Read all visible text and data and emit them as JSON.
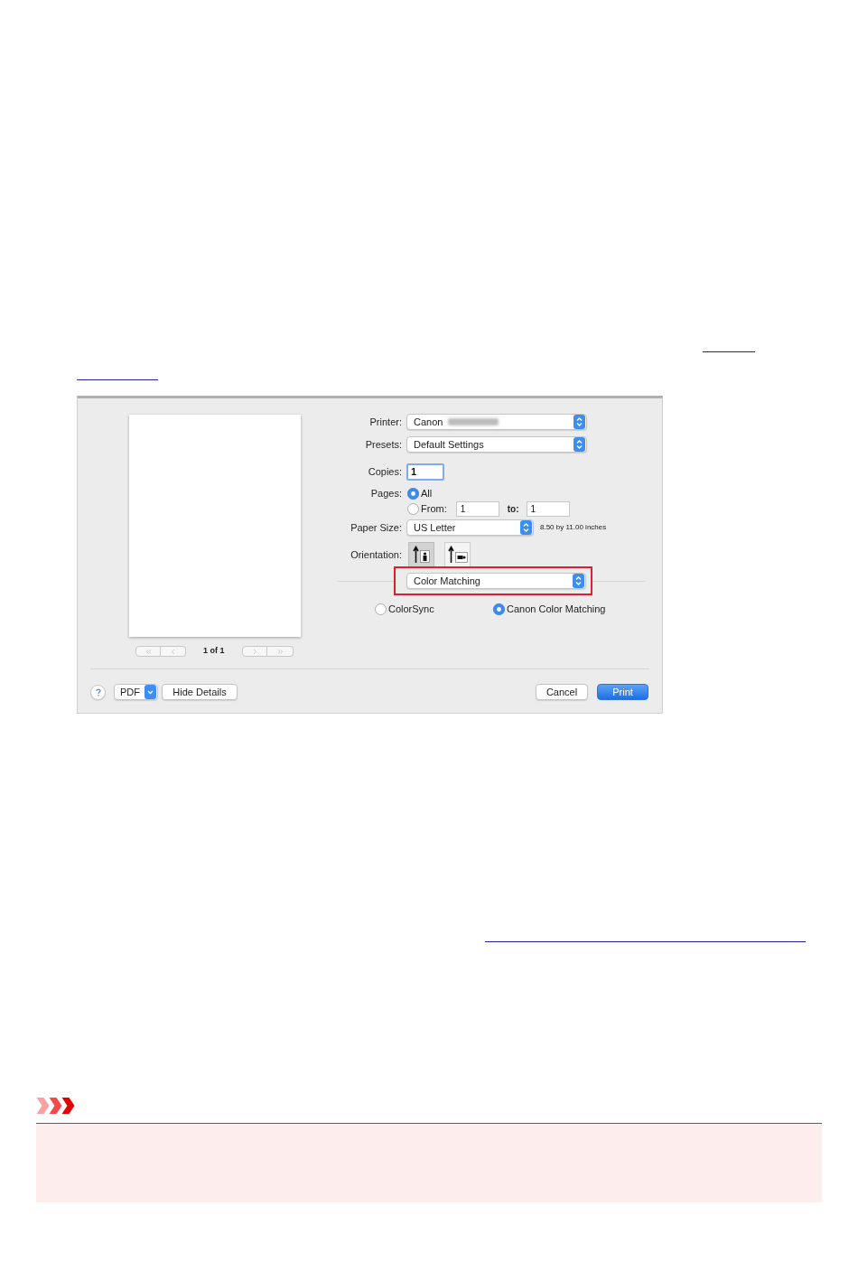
{
  "print_dialog": {
    "preview": {
      "page_counter": "1 of 1"
    },
    "printer": {
      "label": "Printer:",
      "value": "Canon",
      "model_blurred": true
    },
    "presets": {
      "label": "Presets:",
      "value": "Default Settings"
    },
    "copies": {
      "label": "Copies:",
      "value": "1"
    },
    "pages": {
      "label": "Pages:",
      "options": [
        {
          "label": "All",
          "selected": true
        },
        {
          "label": "From:",
          "selected": false
        }
      ],
      "from": "1",
      "to_label": "to:",
      "to": "1"
    },
    "paper_size": {
      "label": "Paper Size:",
      "value": "US Letter",
      "note": "8.50 by 11.00 inches"
    },
    "orientation": {
      "label": "Orientation:",
      "options": [
        {
          "kind": "portrait",
          "selected": true
        },
        {
          "kind": "landscape",
          "selected": false
        }
      ]
    },
    "panel_menu": {
      "value": "Color Matching",
      "highlighted": true
    },
    "color_matching": {
      "options": [
        {
          "label": "ColorSync",
          "selected": false
        },
        {
          "label": "Canon Color Matching",
          "selected": true
        }
      ]
    },
    "footer": {
      "pdf": "PDF",
      "details": "Hide Details",
      "cancel": "Cancel",
      "print": "Print"
    }
  }
}
